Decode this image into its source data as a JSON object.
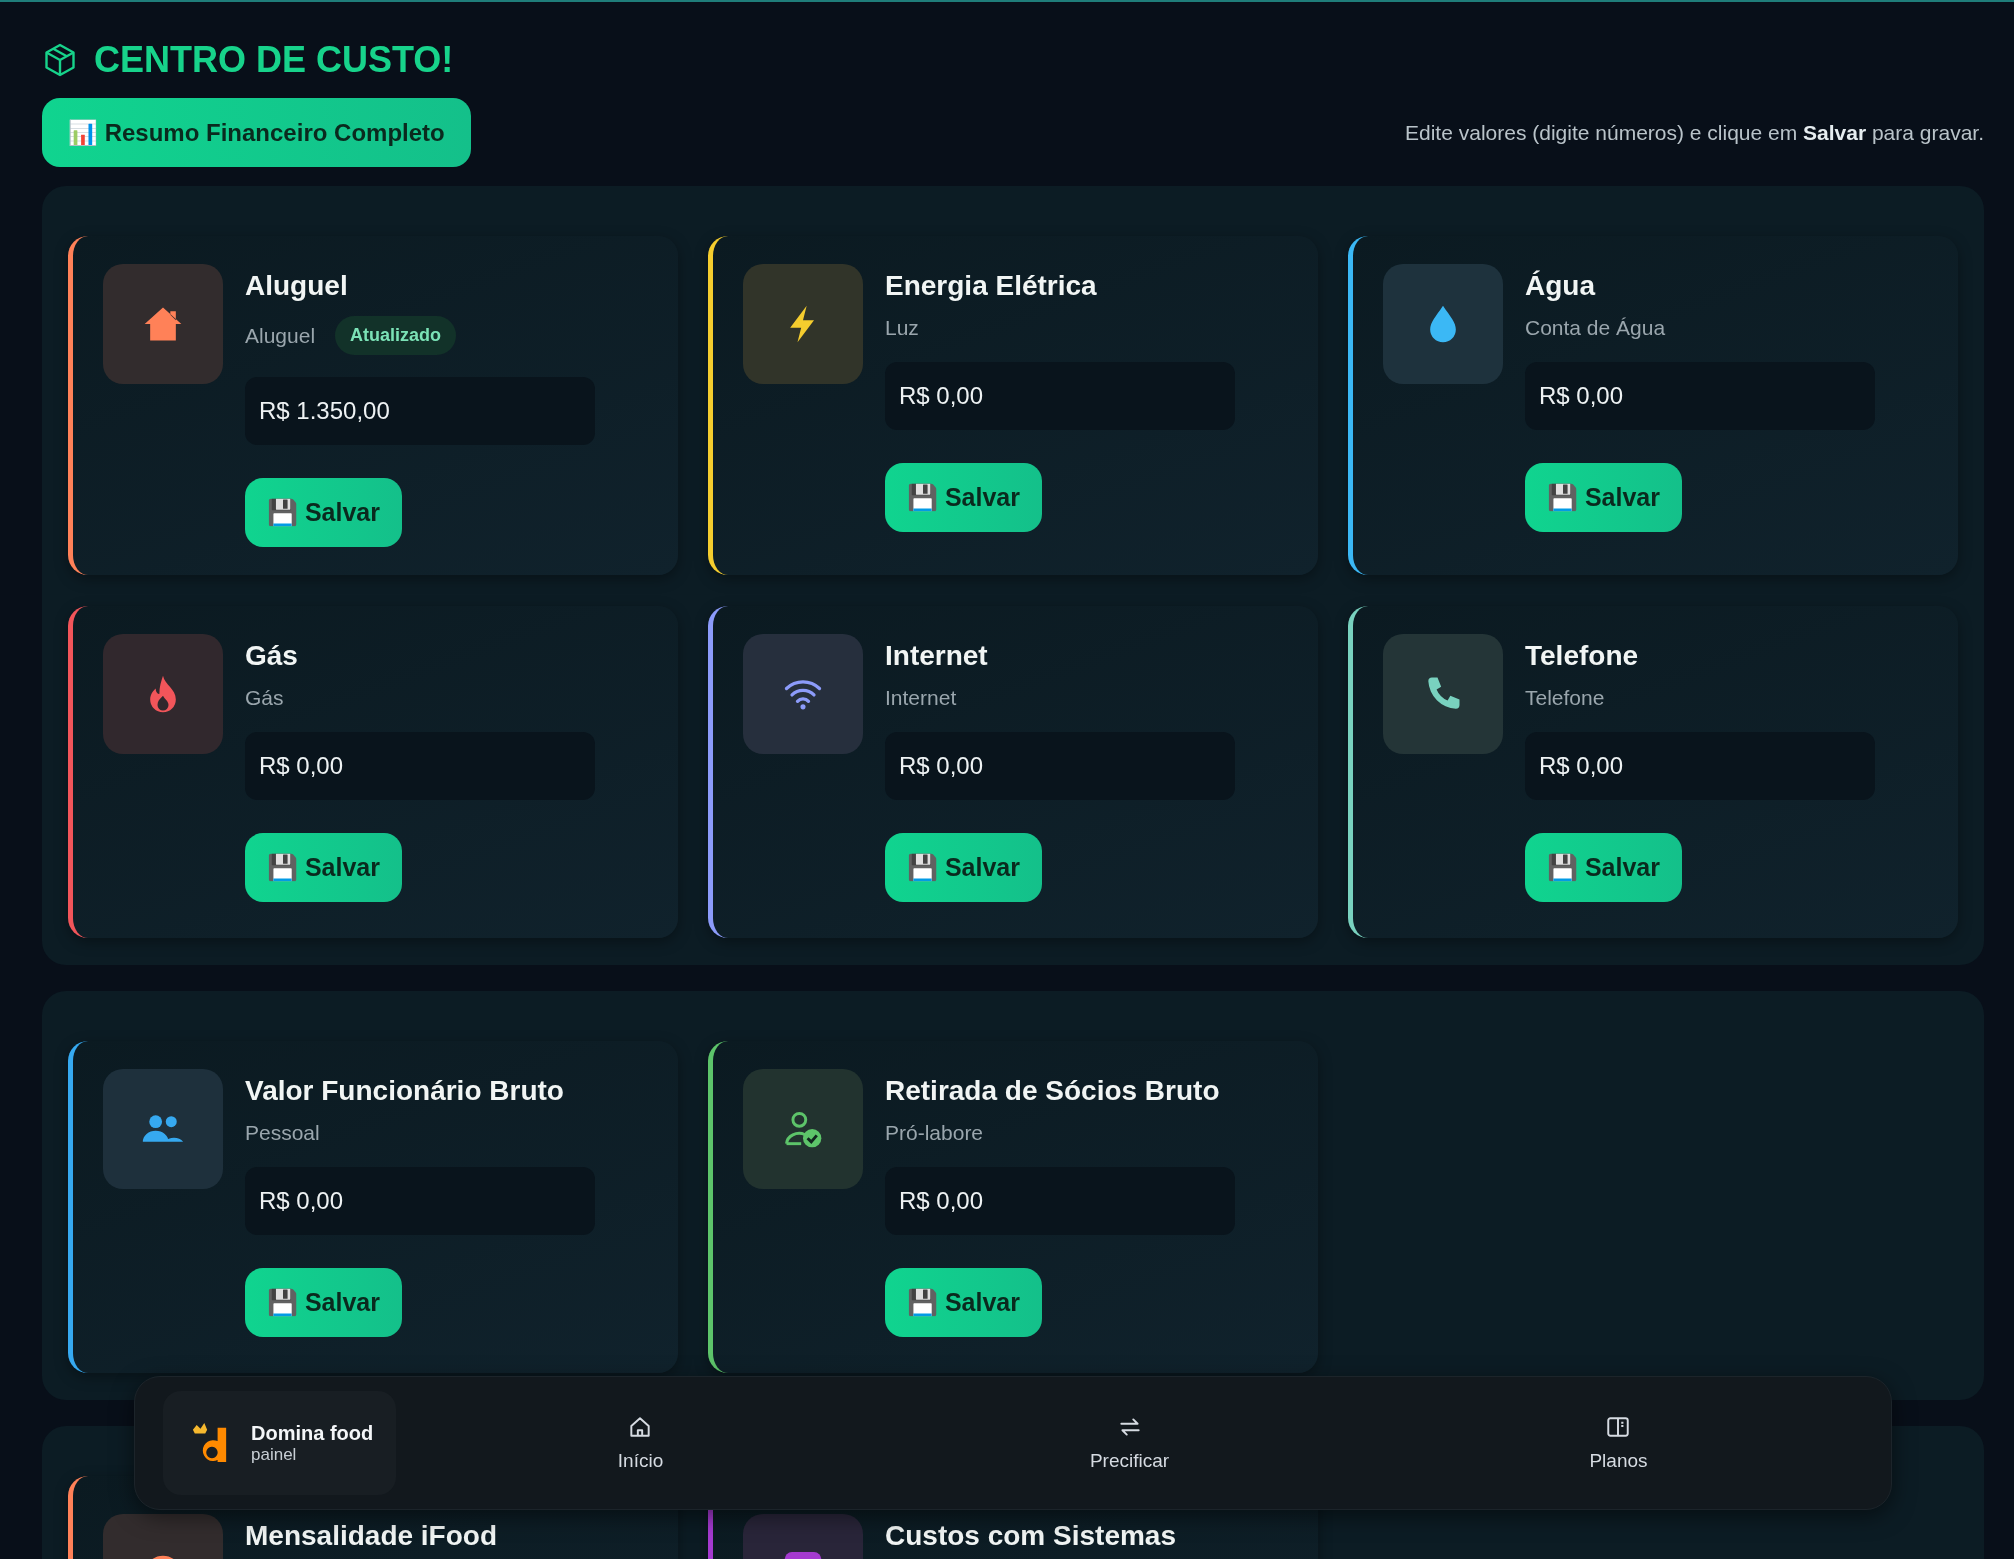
{
  "page": {
    "title": "CENTRO DE CUSTO!",
    "summary_button": "📊 Resumo Financeiro Completo",
    "hint": "Edite valores (digite números) e clique em **Salvar** para gravar."
  },
  "sections": [
    {
      "cards": [
        {
          "title": "Aluguel",
          "subtitle": "Aluguel",
          "badge": "Atualizado",
          "value": "R$ 1.350,00",
          "button": "💾 Salvar",
          "kind": "house",
          "color": "#ff8158"
        },
        {
          "title": "Energia Elétrica",
          "subtitle": "Luz",
          "value": "R$ 0,00",
          "button": "💾 Salvar",
          "kind": "bolt",
          "color": "#f5cd2e"
        },
        {
          "title": "Água",
          "subtitle": "Conta de Água",
          "value": "R$ 0,00",
          "button": "💾 Salvar",
          "kind": "drop",
          "color": "#3bb8f5"
        },
        {
          "title": "Gás",
          "subtitle": "Gás",
          "value": "R$ 0,00",
          "button": "💾 Salvar",
          "kind": "flame",
          "color": "#f2555a"
        },
        {
          "title": "Internet",
          "subtitle": "Internet",
          "value": "R$ 0,00",
          "button": "💾 Salvar",
          "kind": "wifi",
          "color": "#8c9bfa"
        },
        {
          "title": "Telefone",
          "subtitle": "Telefone",
          "value": "R$ 0,00",
          "button": "💾 Salvar",
          "kind": "phone",
          "color": "#79d2bf"
        }
      ]
    },
    {
      "cards": [
        {
          "title": "Valor Funcionário Bruto",
          "subtitle": "Pessoal",
          "value": "R$ 0,00",
          "button": "💾 Salvar",
          "kind": "people",
          "color": "#36a9f0"
        },
        {
          "title": "Retirada de Sócios Bruto",
          "subtitle": "Pró-labore",
          "value": "R$ 0,00",
          "button": "💾 Salvar",
          "kind": "usercheck",
          "color": "#5dc46a"
        }
      ]
    },
    {
      "cards": [
        {
          "title": "Mensalidade iFood",
          "kind": "plate",
          "color": "#ff8158"
        },
        {
          "title": "Custos com Sistemas",
          "kind": "square",
          "color": "#a53ad0"
        }
      ]
    }
  ],
  "bottom_nav": {
    "brand": {
      "name": "Domina food",
      "sub": "painel"
    },
    "items": [
      {
        "label": "Início",
        "kind": "home"
      },
      {
        "label": "Precificar",
        "kind": "swap"
      },
      {
        "label": "Planos",
        "kind": "book"
      }
    ]
  }
}
